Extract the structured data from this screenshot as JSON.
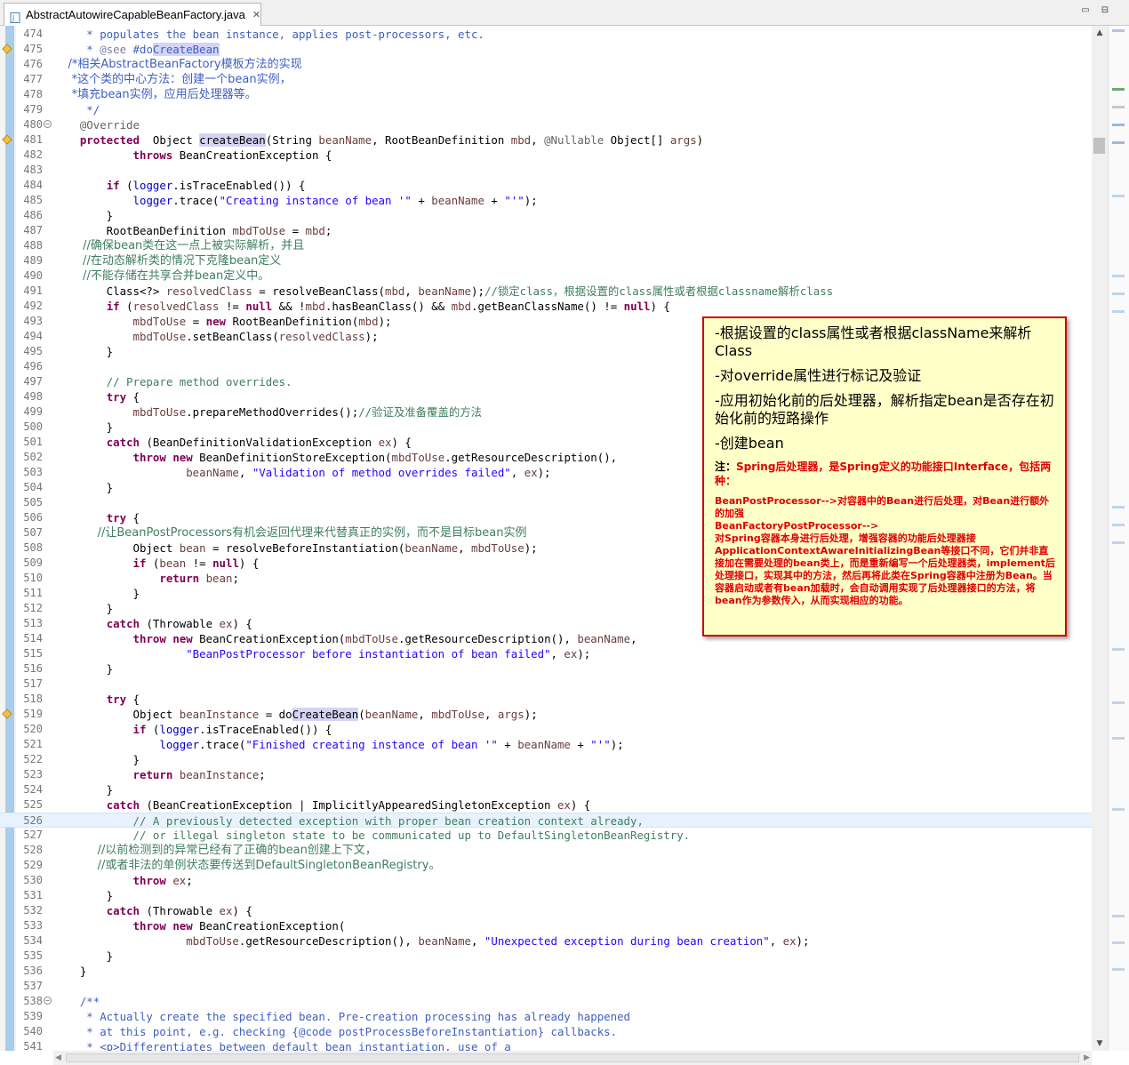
{
  "tab": {
    "title": "AbstractAutowireCapableBeanFactory.java",
    "close": "✕"
  },
  "window": {
    "minimize": "▭",
    "maximize": "⊟"
  },
  "lines": [
    {
      "n": "474",
      "segs": [
        [
          "doc",
          "     * populates the bean instance, applies post-processors, etc."
        ]
      ]
    },
    {
      "n": "475",
      "marker": true,
      "segs": [
        [
          "doc",
          "     * "
        ],
        [
          "tag",
          "@see"
        ],
        [
          "doc",
          " #do"
        ],
        [
          "dochl",
          "CreateBean"
        ]
      ]
    },
    {
      "n": "476",
      "cjk": true,
      "segs": [
        [
          "doc",
          "    /*相关AbstractBeanFactory模板方法的实现"
        ]
      ]
    },
    {
      "n": "477",
      "cjk": true,
      "segs": [
        [
          "doc",
          "     *这个类的中心方法：创建一个bean实例，"
        ]
      ]
    },
    {
      "n": "478",
      "cjk": true,
      "segs": [
        [
          "doc",
          "     *填充bean实例，应用后处理器等。"
        ]
      ]
    },
    {
      "n": "479",
      "segs": [
        [
          "doc",
          "     */"
        ]
      ]
    },
    {
      "n": "480",
      "fold": "−",
      "segs": [
        [
          "ann",
          "    @Override"
        ]
      ]
    },
    {
      "n": "481",
      "marker": true,
      "segs": [
        [
          "kw",
          "    protected"
        ],
        [
          "",
          "  Object "
        ],
        [
          "hl",
          "createBean"
        ],
        [
          "",
          "(String "
        ],
        [
          "var",
          "beanName"
        ],
        [
          "",
          ", RootBeanDefinition "
        ],
        [
          "var",
          "mbd"
        ],
        [
          "",
          ", "
        ],
        [
          "ann",
          "@Nullable"
        ],
        [
          "",
          "",
          " Object[] "
        ],
        [
          "var",
          "args"
        ],
        [
          "",
          ")"
        ]
      ]
    },
    {
      "n": "482",
      "segs": [
        [
          "",
          "            "
        ],
        [
          "kw",
          "throws"
        ],
        [
          "",
          " BeanCreationException {"
        ]
      ]
    },
    {
      "n": "483",
      "segs": [
        [
          "",
          ""
        ]
      ]
    },
    {
      "n": "484",
      "segs": [
        [
          "",
          "        "
        ],
        [
          "kw",
          "if"
        ],
        [
          "",
          " ("
        ],
        [
          "field",
          "logger"
        ],
        [
          "",
          ".isTraceEnabled()) {"
        ]
      ]
    },
    {
      "n": "485",
      "segs": [
        [
          "",
          "            "
        ],
        [
          "field",
          "logger"
        ],
        [
          "",
          ".trace("
        ],
        [
          "str",
          "\"Creating instance of bean '\""
        ],
        [
          "",
          " + "
        ],
        [
          "var",
          "beanName"
        ],
        [
          "",
          " + "
        ],
        [
          "str",
          "\"'\""
        ],
        [
          "",
          ");"
        ]
      ]
    },
    {
      "n": "486",
      "segs": [
        [
          "",
          "        }"
        ]
      ]
    },
    {
      "n": "487",
      "segs": [
        [
          "",
          "        RootBeanDefinition "
        ],
        [
          "var",
          "mbdToUse"
        ],
        [
          "",
          " = "
        ],
        [
          "var",
          "mbd"
        ],
        [
          "",
          ";"
        ]
      ]
    },
    {
      "n": "488",
      "cjk": true,
      "segs": [
        [
          "comment",
          "        //确保bean类在这一点上被实际解析，并且"
        ]
      ]
    },
    {
      "n": "489",
      "cjk": true,
      "segs": [
        [
          "comment",
          "        //在动态解析类的情况下克隆bean定义"
        ]
      ]
    },
    {
      "n": "490",
      "cjk": true,
      "segs": [
        [
          "comment",
          "        //不能存储在共享合并bean定义中。"
        ]
      ]
    },
    {
      "n": "491",
      "segs": [
        [
          "",
          "        Class<?> "
        ],
        [
          "var",
          "resolvedClass"
        ],
        [
          "",
          " = resolveBeanClass("
        ],
        [
          "var",
          "mbd"
        ],
        [
          "",
          ", "
        ],
        [
          "var",
          "beanName"
        ],
        [
          "",
          ");"
        ],
        [
          "comment",
          "//锁定class，根据设置的class属性或者根据classname解析class"
        ]
      ]
    },
    {
      "n": "492",
      "segs": [
        [
          "",
          "        "
        ],
        [
          "kw",
          "if"
        ],
        [
          "",
          " ("
        ],
        [
          "var",
          "resolvedClass"
        ],
        [
          "",
          " != "
        ],
        [
          "kw",
          "null"
        ],
        [
          "",
          " && !"
        ],
        [
          "var",
          "mbd"
        ],
        [
          "",
          ".hasBeanClass() && "
        ],
        [
          "var",
          "mbd"
        ],
        [
          "",
          ".getBeanClassName() != "
        ],
        [
          "kw",
          "null"
        ],
        [
          "",
          ") {"
        ]
      ]
    },
    {
      "n": "493",
      "segs": [
        [
          "",
          "            "
        ],
        [
          "var",
          "mbdToUse"
        ],
        [
          "",
          " = "
        ],
        [
          "kw",
          "new"
        ],
        [
          "",
          " RootBeanDefinition("
        ],
        [
          "var",
          "mbd"
        ],
        [
          "",
          ");"
        ]
      ]
    },
    {
      "n": "494",
      "segs": [
        [
          "",
          "            "
        ],
        [
          "var",
          "mbdToUse"
        ],
        [
          "",
          ".setBeanClass("
        ],
        [
          "var",
          "resolvedClass"
        ],
        [
          "",
          ");"
        ]
      ]
    },
    {
      "n": "495",
      "segs": [
        [
          "",
          "        }"
        ]
      ]
    },
    {
      "n": "496",
      "segs": [
        [
          "",
          ""
        ]
      ]
    },
    {
      "n": "497",
      "segs": [
        [
          "comment",
          "        // Prepare method overrides."
        ]
      ]
    },
    {
      "n": "498",
      "segs": [
        [
          "",
          "        "
        ],
        [
          "kw",
          "try"
        ],
        [
          "",
          " {"
        ]
      ]
    },
    {
      "n": "499",
      "segs": [
        [
          "",
          "            "
        ],
        [
          "var",
          "mbdToUse"
        ],
        [
          "",
          ".prepareMethodOverrides();"
        ],
        [
          "comment",
          "//验证及准备覆盖的方法"
        ]
      ]
    },
    {
      "n": "500",
      "segs": [
        [
          "",
          "        }"
        ]
      ]
    },
    {
      "n": "501",
      "segs": [
        [
          "",
          "        "
        ],
        [
          "kw",
          "catch"
        ],
        [
          "",
          " (BeanDefinitionValidationException "
        ],
        [
          "var",
          "ex"
        ],
        [
          "",
          ") {"
        ]
      ]
    },
    {
      "n": "502",
      "segs": [
        [
          "",
          "            "
        ],
        [
          "kw",
          "throw"
        ],
        [
          "",
          "",
          " "
        ],
        [
          "kw",
          "new"
        ],
        [
          "",
          " BeanDefinitionStoreException("
        ],
        [
          "var",
          "mbdToUse"
        ],
        [
          "",
          ".getResourceDescription(),"
        ]
      ]
    },
    {
      "n": "503",
      "segs": [
        [
          "",
          "                    "
        ],
        [
          "var",
          "beanName"
        ],
        [
          "",
          ", "
        ],
        [
          "str",
          "\"Validation of method overrides failed\""
        ],
        [
          "",
          ", "
        ],
        [
          "var",
          "ex"
        ],
        [
          "",
          ");"
        ]
      ]
    },
    {
      "n": "504",
      "segs": [
        [
          "",
          "        }"
        ]
      ]
    },
    {
      "n": "505",
      "segs": [
        [
          "",
          ""
        ]
      ]
    },
    {
      "n": "506",
      "segs": [
        [
          "",
          "        "
        ],
        [
          "kw",
          "try"
        ],
        [
          "",
          " {"
        ]
      ]
    },
    {
      "n": "507",
      "cjk": true,
      "segs": [
        [
          "comment",
          "            //让BeanPostProcessors有机会返回代理来代替真正的实例，而不是目标bean实例"
        ]
      ]
    },
    {
      "n": "508",
      "segs": [
        [
          "",
          "            Object "
        ],
        [
          "var",
          "bean"
        ],
        [
          "",
          " = resolveBeforeInstantiation("
        ],
        [
          "var",
          "beanName"
        ],
        [
          "",
          ", "
        ],
        [
          "var",
          "mbdToUse"
        ],
        [
          "",
          ");"
        ]
      ]
    },
    {
      "n": "509",
      "segs": [
        [
          "",
          "            "
        ],
        [
          "kw",
          "if"
        ],
        [
          "",
          " ("
        ],
        [
          "var",
          "bean"
        ],
        [
          "",
          " != "
        ],
        [
          "kw",
          "null"
        ],
        [
          "",
          ") {"
        ]
      ]
    },
    {
      "n": "510",
      "segs": [
        [
          "",
          "                "
        ],
        [
          "kw",
          "return"
        ],
        [
          "",
          " "
        ],
        [
          "var",
          "bean"
        ],
        [
          "",
          ";"
        ]
      ]
    },
    {
      "n": "511",
      "segs": [
        [
          "",
          "            }"
        ]
      ]
    },
    {
      "n": "512",
      "segs": [
        [
          "",
          "        }"
        ]
      ]
    },
    {
      "n": "513",
      "segs": [
        [
          "",
          "        "
        ],
        [
          "kw",
          "catch"
        ],
        [
          "",
          " (Throwable "
        ],
        [
          "var",
          "ex"
        ],
        [
          "",
          ") {"
        ]
      ]
    },
    {
      "n": "514",
      "segs": [
        [
          "",
          "            "
        ],
        [
          "kw",
          "throw"
        ],
        [
          "",
          " "
        ],
        [
          "kw",
          "new"
        ],
        [
          "",
          " BeanCreationException("
        ],
        [
          "var",
          "mbdToUse"
        ],
        [
          "",
          ".getResourceDescription(), "
        ],
        [
          "var",
          "beanName"
        ],
        [
          "",
          ","
        ]
      ]
    },
    {
      "n": "515",
      "segs": [
        [
          "",
          "                    "
        ],
        [
          "str",
          "\"BeanPostProcessor before instantiation of bean failed\""
        ],
        [
          "",
          ", "
        ],
        [
          "var",
          "ex"
        ],
        [
          "",
          ");"
        ]
      ]
    },
    {
      "n": "516",
      "segs": [
        [
          "",
          "        }"
        ]
      ]
    },
    {
      "n": "517",
      "segs": [
        [
          "",
          ""
        ]
      ]
    },
    {
      "n": "518",
      "segs": [
        [
          "",
          "        "
        ],
        [
          "kw",
          "try"
        ],
        [
          "",
          " {"
        ]
      ]
    },
    {
      "n": "519",
      "marker": true,
      "segs": [
        [
          "",
          "            Object "
        ],
        [
          "var",
          "beanInstance"
        ],
        [
          "",
          " = do"
        ],
        [
          "hl",
          "CreateBean"
        ],
        [
          "",
          "("
        ],
        [
          "var",
          "beanName"
        ],
        [
          "",
          ", "
        ],
        [
          "var",
          "mbdToUse"
        ],
        [
          "",
          ", "
        ],
        [
          "var",
          "args"
        ],
        [
          "",
          ");"
        ]
      ]
    },
    {
      "n": "520",
      "segs": [
        [
          "",
          "            "
        ],
        [
          "kw",
          "if"
        ],
        [
          "",
          " ("
        ],
        [
          "field",
          "logger"
        ],
        [
          "",
          ".isTraceEnabled()) {"
        ]
      ]
    },
    {
      "n": "521",
      "segs": [
        [
          "",
          "                "
        ],
        [
          "field",
          "logger"
        ],
        [
          "",
          ".trace("
        ],
        [
          "str",
          "\"Finished creating instance of bean '\""
        ],
        [
          "",
          " + "
        ],
        [
          "var",
          "beanName"
        ],
        [
          "",
          " + "
        ],
        [
          "str",
          "\"'\""
        ],
        [
          "",
          ");"
        ]
      ]
    },
    {
      "n": "522",
      "segs": [
        [
          "",
          "            }"
        ]
      ]
    },
    {
      "n": "523",
      "segs": [
        [
          "",
          "            "
        ],
        [
          "kw",
          "return"
        ],
        [
          "",
          " "
        ],
        [
          "var",
          "beanInstance"
        ],
        [
          "",
          ";"
        ]
      ]
    },
    {
      "n": "524",
      "segs": [
        [
          "",
          "        }"
        ]
      ]
    },
    {
      "n": "525",
      "segs": [
        [
          "",
          "        "
        ],
        [
          "kw",
          "catch"
        ],
        [
          "",
          " (BeanCreationException | ImplicitlyAppearedSingletonException "
        ],
        [
          "var",
          "ex"
        ],
        [
          "",
          ") {"
        ]
      ]
    },
    {
      "n": "526",
      "current": true,
      "segs": [
        [
          "comment",
          "            // A previously detected exception with proper bean creation context already,"
        ]
      ]
    },
    {
      "n": "527",
      "segs": [
        [
          "comment",
          "            // or illegal singleton state to be communicated up to DefaultSingletonBeanRegistry."
        ]
      ]
    },
    {
      "n": "528",
      "cjk": true,
      "segs": [
        [
          "comment",
          "            //以前检测到的异常已经有了正确的bean创建上下文，"
        ]
      ]
    },
    {
      "n": "529",
      "cjk": true,
      "segs": [
        [
          "comment",
          "            //或者非法的单例状态要传送到DefaultSingletonBeanRegistry。"
        ]
      ]
    },
    {
      "n": "530",
      "segs": [
        [
          "",
          "            "
        ],
        [
          "kw",
          "throw"
        ],
        [
          "",
          " "
        ],
        [
          "var",
          "ex"
        ],
        [
          "",
          ";"
        ]
      ]
    },
    {
      "n": "531",
      "segs": [
        [
          "",
          "        }"
        ]
      ]
    },
    {
      "n": "532",
      "segs": [
        [
          "",
          "        "
        ],
        [
          "kw",
          "catch"
        ],
        [
          "",
          " (Throwable "
        ],
        [
          "var",
          "ex"
        ],
        [
          "",
          ") {"
        ]
      ]
    },
    {
      "n": "533",
      "segs": [
        [
          "",
          "            "
        ],
        [
          "kw",
          "throw"
        ],
        [
          "",
          " "
        ],
        [
          "kw",
          "new"
        ],
        [
          "",
          " BeanCreationException("
        ]
      ]
    },
    {
      "n": "534",
      "segs": [
        [
          "",
          "                    "
        ],
        [
          "var",
          "mbdToUse"
        ],
        [
          "",
          ".getResourceDescription(), "
        ],
        [
          "var",
          "beanName"
        ],
        [
          "",
          ", "
        ],
        [
          "str",
          "\"Unexpected exception during bean creation\""
        ],
        [
          "",
          ", "
        ],
        [
          "var",
          "ex"
        ],
        [
          "",
          ");"
        ]
      ]
    },
    {
      "n": "535",
      "segs": [
        [
          "",
          "        }"
        ]
      ]
    },
    {
      "n": "536",
      "segs": [
        [
          "",
          "    }"
        ]
      ]
    },
    {
      "n": "537",
      "segs": [
        [
          "",
          ""
        ]
      ]
    },
    {
      "n": "538",
      "fold": "−",
      "segs": [
        [
          "doc",
          "    /**"
        ]
      ]
    },
    {
      "n": "539",
      "segs": [
        [
          "doc",
          "     * Actually create the specified bean. Pre-creation processing has already happened"
        ]
      ]
    },
    {
      "n": "540",
      "segs": [
        [
          "doc",
          "     * at this point, e.g. checking {@code postProcessBeforeInstantiation} callbacks."
        ]
      ]
    },
    {
      "n": "541",
      "segs": [
        [
          "doc",
          "     * <p>Differentiates between default bean instantiation, use of a"
        ]
      ]
    }
  ],
  "note": {
    "item1": "-根据设置的class属性或者根据className来解析Class",
    "item2": "-对override属性进行标记及验证",
    "item3": "-应用初始化前的后处理器，解析指定bean是否存在初始化前的短路操作",
    "item4": "-创建bean",
    "note_label": "注：",
    "note_head": "Spring后处理器，是Spring定义的功能接口Interface，包括两种：",
    "bpp": "BeanPostProcessor-->对容器中的Bean进行后处理，对Bean进行额外的加强",
    "bfpp_title": "BeanFactoryPostProcessor-->",
    "bfpp_body": "对Spring容器本身进行后处理，增强容器的功能后处理器接ApplicationContextAwareInitializingBean等接口不同，它们并非直接加在需要处理的bean类上，而是重新编写一个后处理器类，implement后处理接口，实现其中的方法，然后再将此类在Spring容器中注册为Bean。当容器启动或者有bean加载时，会自动调用实现了后处理器接口的方法，将bean作为参数传入，从而实现相应的功能。"
  },
  "colors": {
    "keyword": "#7f0055",
    "comment": "#3f7f5f",
    "javadoc": "#3f5fbf",
    "string": "#2a00ff",
    "note_border": "#cc0000",
    "note_bg": "#ffffc8"
  }
}
